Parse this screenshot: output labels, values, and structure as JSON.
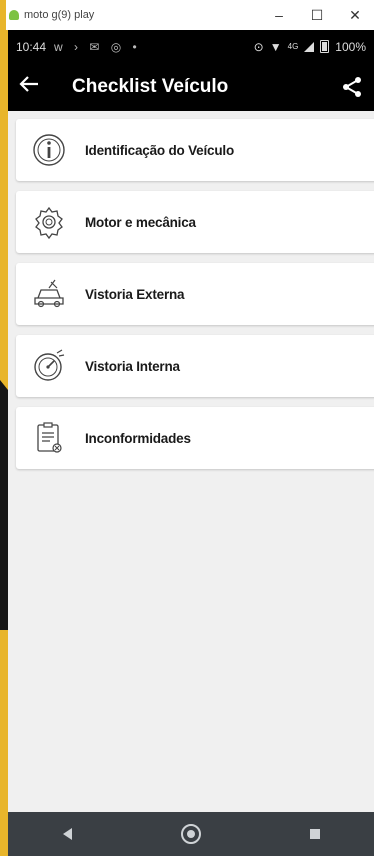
{
  "window": {
    "title": "moto g(9) play",
    "controls": {
      "minimize": "–",
      "maximize": "☐",
      "close": "✕"
    }
  },
  "statusbar": {
    "time": "10:44",
    "notifications": "ᴡ › ✉ ◎ •",
    "network": "4G",
    "battery": "100%"
  },
  "appbar": {
    "back_icon": "arrow-left-icon",
    "title": "Checklist Veículo",
    "share_icon": "share-icon"
  },
  "menu": {
    "items": [
      {
        "label": "Identificação do Veículo",
        "icon": "info-icon"
      },
      {
        "label": "Motor e mecânica",
        "icon": "engine-gear-icon"
      },
      {
        "label": "Vistoria Externa",
        "icon": "car-exterior-icon"
      },
      {
        "label": "Vistoria Interna",
        "icon": "speedometer-icon"
      },
      {
        "label": "Inconformidades",
        "icon": "clipboard-icon"
      }
    ]
  },
  "navbar": {
    "back": "nav-back-icon",
    "home": "nav-home-icon",
    "recent": "nav-recent-icon"
  },
  "colors": {
    "background": "#e8b52b",
    "appbar": "#000000",
    "card": "#ffffff",
    "navbar": "#3a3f44"
  }
}
